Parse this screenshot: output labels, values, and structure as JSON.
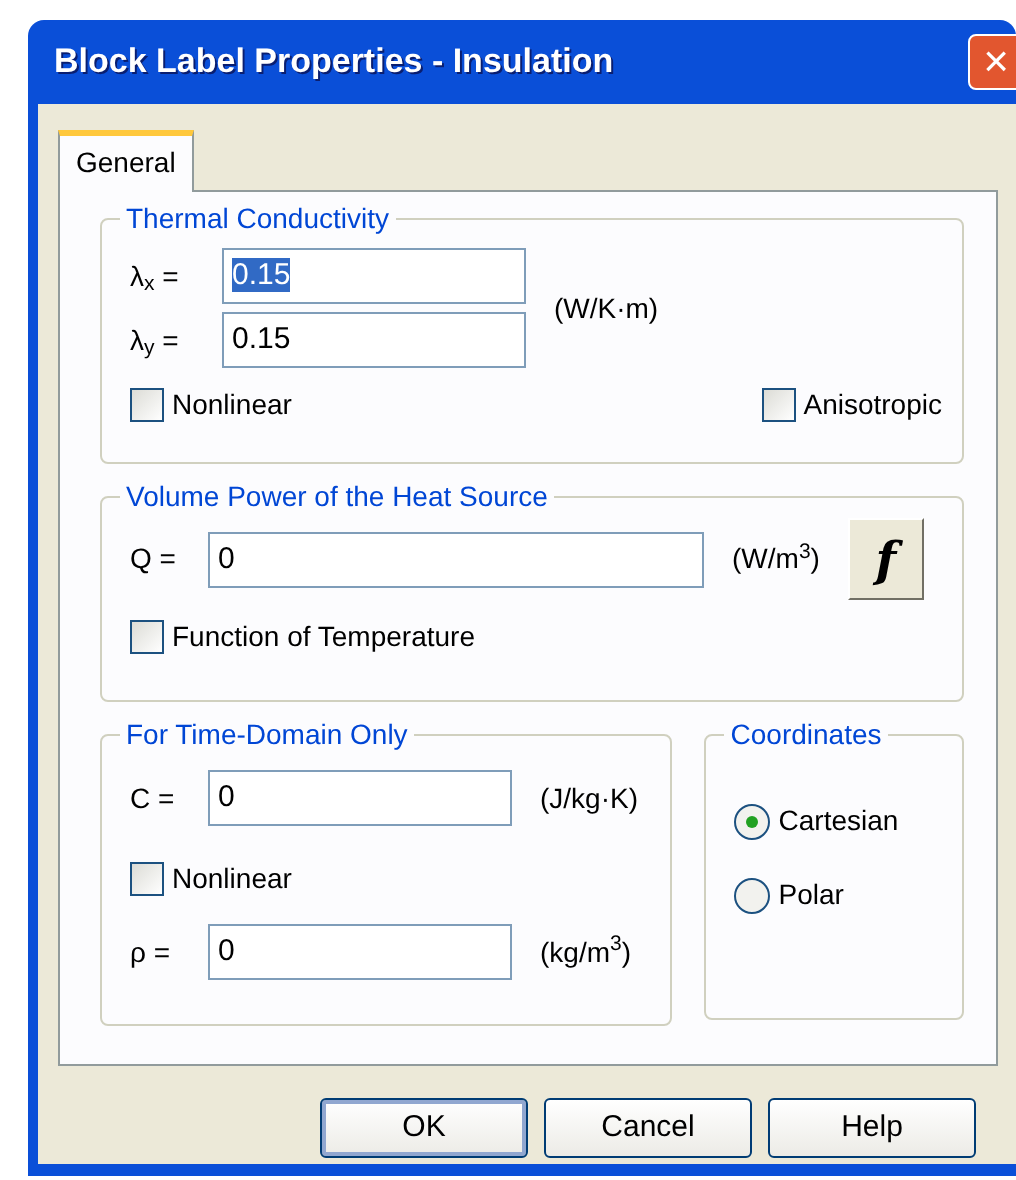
{
  "window": {
    "title": "Block Label Properties - Insulation",
    "close": "×"
  },
  "tabs": [
    {
      "label": "General",
      "selected": true
    }
  ],
  "thermal_conductivity": {
    "title": "Thermal Conductivity",
    "fields": [
      {
        "label": "λ$_{x}$ =",
        "value": "0.15",
        "text_selected": true
      },
      {
        "label": "λ$_{y}$ =",
        "value": "0.15",
        "text_selected": false
      }
    ],
    "unit": "(W/K·m)",
    "nonlinear": {
      "label": "Nonlinear",
      "checked": false
    },
    "anisotropic": {
      "label": "Anisotropic",
      "checked": false
    }
  },
  "heat_source": {
    "title": "Volume Power of the Heat Source",
    "label": "Q =",
    "value": "0",
    "unit": "(W/m$^{3}$)",
    "function_button": "f",
    "function_of_temperature": {
      "label": "Function of Temperature",
      "checked": false
    }
  },
  "time_domain": {
    "title": "For Time-Domain Only",
    "c": {
      "label": "C =",
      "value": "0",
      "unit": "(J/kg·K)"
    },
    "nonlinear": {
      "label": "Nonlinear",
      "checked": false
    },
    "rho": {
      "label": "ρ =",
      "value": "0",
      "unit": "(kg/m$^{3}$)"
    }
  },
  "coordinates": {
    "title": "Coordinates",
    "options": [
      {
        "label": "Cartesian",
        "selected": true
      },
      {
        "label": "Polar",
        "selected": false
      }
    ]
  },
  "buttons": [
    {
      "label": "OK",
      "default": true
    },
    {
      "label": "Cancel",
      "default": false
    },
    {
      "label": "Help",
      "default": false
    }
  ]
}
